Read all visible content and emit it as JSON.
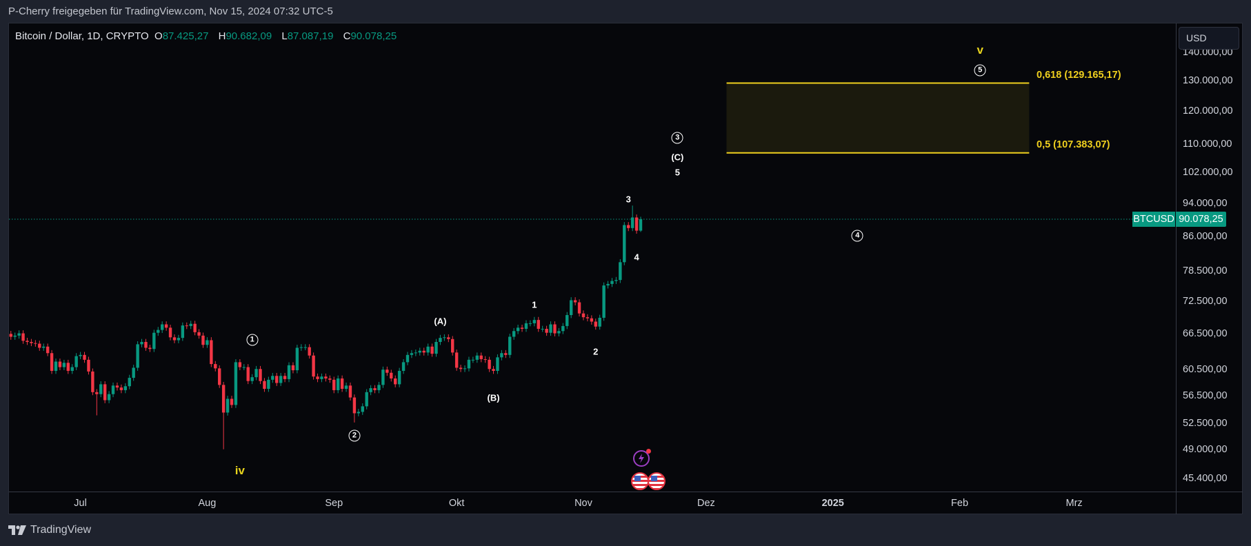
{
  "share_text": "P-Cherry freigegeben für TradingView.com, Nov 15, 2024 07:32 UTC-5",
  "legend": {
    "symbol": "Bitcoin / Dollar, 1D, CRYPTO",
    "o_key": "O",
    "o": "87.425,27",
    "h_key": "H",
    "h": "90.682,09",
    "l_key": "L",
    "l": "87.087,19",
    "c_key": "C",
    "c": "90.078,25"
  },
  "currency_button": "USD",
  "price_tag": {
    "symbol": "BTCUSD",
    "value": "90.078,25",
    "price": 90078.25
  },
  "colors": {
    "up": "#089981",
    "down": "#f23645",
    "fib": "#f0d01e",
    "wave": "#ffffff",
    "wave_degree": "#e8d41d",
    "background": "#06070b"
  },
  "footer": {
    "logo_icon": "tradingview-logo-icon",
    "brand": "TradingView"
  },
  "events": [
    {
      "icon": "lightning-icon",
      "date": "2024-11-15"
    },
    {
      "icon": "us-flag-icon",
      "date": "2024-11-15"
    },
    {
      "icon": "us-flag-icon",
      "date": "2024-11-19"
    }
  ],
  "chart_data": {
    "type": "candlestick",
    "scale": "log",
    "ylim": [
      44500,
      146000
    ],
    "xlim": [
      "2024-06-14",
      "2025-03-20"
    ],
    "yticks": [
      {
        "value": 140000,
        "label": "140.000,00"
      },
      {
        "value": 130000,
        "label": "130.000,00"
      },
      {
        "value": 120000,
        "label": "120.000,00"
      },
      {
        "value": 110000,
        "label": "110.000,00"
      },
      {
        "value": 102000,
        "label": "102.000,00"
      },
      {
        "value": 94000,
        "label": "94.000,00"
      },
      {
        "value": 86000,
        "label": "86.000,00"
      },
      {
        "value": 78500,
        "label": "78.500,00"
      },
      {
        "value": 72500,
        "label": "72.500,00"
      },
      {
        "value": 66500,
        "label": "66.500,00"
      },
      {
        "value": 60500,
        "label": "60.500,00"
      },
      {
        "value": 56500,
        "label": "56.500,00"
      },
      {
        "value": 52500,
        "label": "52.500,00"
      },
      {
        "value": 49000,
        "label": "49.000,00"
      },
      {
        "value": 45400,
        "label": "45.400,00"
      }
    ],
    "xticks": [
      {
        "date": "2024-07-01",
        "label": "Jul"
      },
      {
        "date": "2024-08-01",
        "label": "Aug"
      },
      {
        "date": "2024-09-01",
        "label": "Sep"
      },
      {
        "date": "2024-10-01",
        "label": "Okt"
      },
      {
        "date": "2024-11-01",
        "label": "Nov"
      },
      {
        "date": "2024-12-01",
        "label": "Dez"
      },
      {
        "date": "2025-01-01",
        "label": "2025",
        "bold": true
      },
      {
        "date": "2025-02-01",
        "label": "Feb"
      },
      {
        "date": "2025-03-01",
        "label": "Mrz"
      }
    ],
    "first_open": 66500,
    "closes": [
      [
        "2024-06-14",
        66000
      ],
      [
        "2024-06-15",
        66200
      ],
      [
        "2024-06-16",
        66600
      ],
      [
        "2024-06-17",
        65300
      ],
      [
        "2024-06-18",
        65100
      ],
      [
        "2024-06-19",
        64900
      ],
      [
        "2024-06-20",
        64800
      ],
      [
        "2024-06-21",
        64100
      ],
      [
        "2024-06-22",
        64300
      ],
      [
        "2024-06-23",
        63200
      ],
      [
        "2024-06-24",
        60300
      ],
      [
        "2024-06-25",
        61800
      ],
      [
        "2024-06-26",
        60900
      ],
      [
        "2024-06-27",
        61600
      ],
      [
        "2024-06-28",
        60300
      ],
      [
        "2024-06-29",
        60900
      ],
      [
        "2024-06-30",
        62700
      ],
      [
        "2024-07-01",
        62900
      ],
      [
        "2024-07-02",
        62100
      ],
      [
        "2024-07-03",
        60200
      ],
      [
        "2024-07-04",
        57000
      ],
      [
        "2024-07-05",
        56700
      ],
      [
        "2024-07-06",
        58200
      ],
      [
        "2024-07-07",
        55800
      ],
      [
        "2024-07-08",
        56700
      ],
      [
        "2024-07-09",
        58000
      ],
      [
        "2024-07-10",
        57700
      ],
      [
        "2024-07-11",
        57300
      ],
      [
        "2024-07-12",
        57900
      ],
      [
        "2024-07-13",
        59200
      ],
      [
        "2024-07-14",
        60800
      ],
      [
        "2024-07-15",
        64700
      ],
      [
        "2024-07-16",
        65100
      ],
      [
        "2024-07-17",
        64100
      ],
      [
        "2024-07-18",
        63900
      ],
      [
        "2024-07-19",
        66700
      ],
      [
        "2024-07-20",
        67200
      ],
      [
        "2024-07-21",
        68200
      ],
      [
        "2024-07-22",
        67600
      ],
      [
        "2024-07-23",
        65900
      ],
      [
        "2024-07-24",
        65400
      ],
      [
        "2024-07-25",
        65800
      ],
      [
        "2024-07-26",
        68000
      ],
      [
        "2024-07-27",
        67900
      ],
      [
        "2024-07-28",
        68300
      ],
      [
        "2024-07-29",
        66800
      ],
      [
        "2024-07-30",
        66200
      ],
      [
        "2024-07-31",
        64600
      ],
      [
        "2024-08-01",
        65400
      ],
      [
        "2024-08-02",
        61400
      ],
      [
        "2024-08-03",
        60700
      ],
      [
        "2024-08-04",
        58100
      ],
      [
        "2024-08-05",
        54000
      ],
      [
        "2024-08-06",
        56000
      ],
      [
        "2024-08-07",
        55100
      ],
      [
        "2024-08-08",
        61700
      ],
      [
        "2024-08-09",
        60900
      ],
      [
        "2024-08-10",
        60900
      ],
      [
        "2024-08-11",
        58700
      ],
      [
        "2024-08-12",
        59300
      ],
      [
        "2024-08-13",
        60600
      ],
      [
        "2024-08-14",
        58700
      ],
      [
        "2024-08-15",
        57500
      ],
      [
        "2024-08-16",
        58900
      ],
      [
        "2024-08-17",
        59500
      ],
      [
        "2024-08-18",
        58400
      ],
      [
        "2024-08-19",
        59500
      ],
      [
        "2024-08-20",
        59000
      ],
      [
        "2024-08-21",
        61200
      ],
      [
        "2024-08-22",
        60400
      ],
      [
        "2024-08-23",
        64100
      ],
      [
        "2024-08-24",
        64200
      ],
      [
        "2024-08-25",
        64200
      ],
      [
        "2024-08-26",
        62800
      ],
      [
        "2024-08-27",
        59400
      ],
      [
        "2024-08-28",
        59000
      ],
      [
        "2024-08-29",
        59400
      ],
      [
        "2024-08-30",
        59100
      ],
      [
        "2024-08-31",
        58900
      ],
      [
        "2024-09-01",
        57300
      ],
      [
        "2024-09-02",
        59100
      ],
      [
        "2024-09-03",
        57500
      ],
      [
        "2024-09-04",
        58000
      ],
      [
        "2024-09-05",
        56200
      ],
      [
        "2024-09-06",
        53900
      ],
      [
        "2024-09-07",
        54100
      ],
      [
        "2024-09-08",
        54900
      ],
      [
        "2024-09-09",
        57000
      ],
      [
        "2024-09-10",
        57600
      ],
      [
        "2024-09-11",
        57300
      ],
      [
        "2024-09-12",
        58100
      ],
      [
        "2024-09-13",
        60500
      ],
      [
        "2024-09-14",
        60000
      ],
      [
        "2024-09-15",
        59100
      ],
      [
        "2024-09-16",
        58200
      ],
      [
        "2024-09-17",
        60300
      ],
      [
        "2024-09-18",
        61700
      ],
      [
        "2024-09-19",
        62900
      ],
      [
        "2024-09-20",
        63200
      ],
      [
        "2024-09-21",
        63300
      ],
      [
        "2024-09-22",
        63600
      ],
      [
        "2024-09-23",
        63300
      ],
      [
        "2024-09-24",
        64300
      ],
      [
        "2024-09-25",
        63100
      ],
      [
        "2024-09-26",
        65100
      ],
      [
        "2024-09-27",
        65800
      ],
      [
        "2024-09-28",
        65900
      ],
      [
        "2024-09-29",
        65600
      ],
      [
        "2024-09-30",
        63300
      ],
      [
        "2024-10-01",
        60800
      ],
      [
        "2024-10-02",
        60600
      ],
      [
        "2024-10-03",
        60700
      ],
      [
        "2024-10-04",
        62100
      ],
      [
        "2024-10-05",
        62100
      ],
      [
        "2024-10-06",
        62800
      ],
      [
        "2024-10-07",
        62200
      ],
      [
        "2024-10-08",
        62100
      ],
      [
        "2024-10-09",
        60600
      ],
      [
        "2024-10-10",
        60300
      ],
      [
        "2024-10-11",
        62500
      ],
      [
        "2024-10-12",
        63200
      ],
      [
        "2024-10-13",
        62900
      ],
      [
        "2024-10-14",
        66000
      ],
      [
        "2024-10-15",
        67000
      ],
      [
        "2024-10-16",
        67600
      ],
      [
        "2024-10-17",
        67400
      ],
      [
        "2024-10-18",
        68400
      ],
      [
        "2024-10-19",
        68400
      ],
      [
        "2024-10-20",
        69000
      ],
      [
        "2024-10-21",
        67400
      ],
      [
        "2024-10-22",
        67400
      ],
      [
        "2024-10-23",
        66700
      ],
      [
        "2024-10-24",
        68200
      ],
      [
        "2024-10-25",
        66600
      ],
      [
        "2024-10-26",
        67000
      ],
      [
        "2024-10-27",
        67900
      ],
      [
        "2024-10-28",
        69900
      ],
      [
        "2024-10-29",
        72700
      ],
      [
        "2024-10-30",
        72300
      ],
      [
        "2024-10-31",
        70200
      ],
      [
        "2024-11-01",
        69500
      ],
      [
        "2024-11-02",
        69300
      ],
      [
        "2024-11-03",
        68700
      ],
      [
        "2024-11-04",
        67800
      ],
      [
        "2024-11-05",
        69400
      ],
      [
        "2024-11-06",
        75600
      ],
      [
        "2024-11-07",
        75900
      ],
      [
        "2024-11-08",
        76500
      ],
      [
        "2024-11-09",
        76700
      ],
      [
        "2024-11-10",
        80400
      ],
      [
        "2024-11-11",
        88700
      ],
      [
        "2024-11-12",
        88000
      ],
      [
        "2024-11-13",
        90500
      ],
      [
        "2024-11-14",
        87400
      ],
      [
        "2024-11-15",
        90078.25
      ]
    ],
    "notable_extremes": [
      {
        "date": "2024-08-05",
        "low": 49000
      },
      {
        "date": "2024-09-06",
        "low": 52600
      },
      {
        "date": "2024-07-05",
        "low": 53600
      },
      {
        "date": "2024-11-13",
        "high": 93400
      },
      {
        "date": "2024-11-15",
        "high": 90682.09,
        "low": 87087.19
      }
    ],
    "fib_zone": {
      "start": "2024-12-06",
      "end": "2025-02-18",
      "levels": [
        {
          "ratio": "0,618",
          "price": 129165.17,
          "label": "0,618 (129.165,17)"
        },
        {
          "ratio": "0,5",
          "price": 107383.07,
          "label": "0,5 (107.383,07)"
        }
      ]
    },
    "wave_labels": [
      {
        "text": "v",
        "date": "2025-02-06",
        "price": 140900,
        "style": "degree"
      },
      {
        "text": "5",
        "date": "2025-02-06",
        "price": 133600,
        "style": "circle"
      },
      {
        "text": "3",
        "date": "2024-11-24",
        "price": 111700,
        "style": "circle"
      },
      {
        "text": "(C)",
        "date": "2024-11-24",
        "price": 106100,
        "style": "plain"
      },
      {
        "text": "5",
        "date": "2024-11-24",
        "price": 102000,
        "style": "plain"
      },
      {
        "text": "3",
        "date": "2024-11-12",
        "price": 94900,
        "style": "plain"
      },
      {
        "text": "4",
        "date": "2024-11-14",
        "price": 81500,
        "style": "plain"
      },
      {
        "text": "4",
        "date": "2025-01-07",
        "price": 86200,
        "style": "circle"
      },
      {
        "text": "1",
        "date": "2024-08-12",
        "price": 65400,
        "style": "circle"
      },
      {
        "text": "iv",
        "date": "2024-08-09",
        "price": 46300,
        "style": "degree"
      },
      {
        "text": "2",
        "date": "2024-09-06",
        "price": 50800,
        "style": "circle"
      },
      {
        "text": "(A)",
        "date": "2024-09-27",
        "price": 68800,
        "style": "plain"
      },
      {
        "text": "(B)",
        "date": "2024-10-10",
        "price": 56200,
        "style": "plain"
      },
      {
        "text": "1",
        "date": "2024-10-20",
        "price": 71800,
        "style": "plain"
      },
      {
        "text": "2",
        "date": "2024-11-04",
        "price": 63500,
        "style": "plain"
      }
    ]
  }
}
